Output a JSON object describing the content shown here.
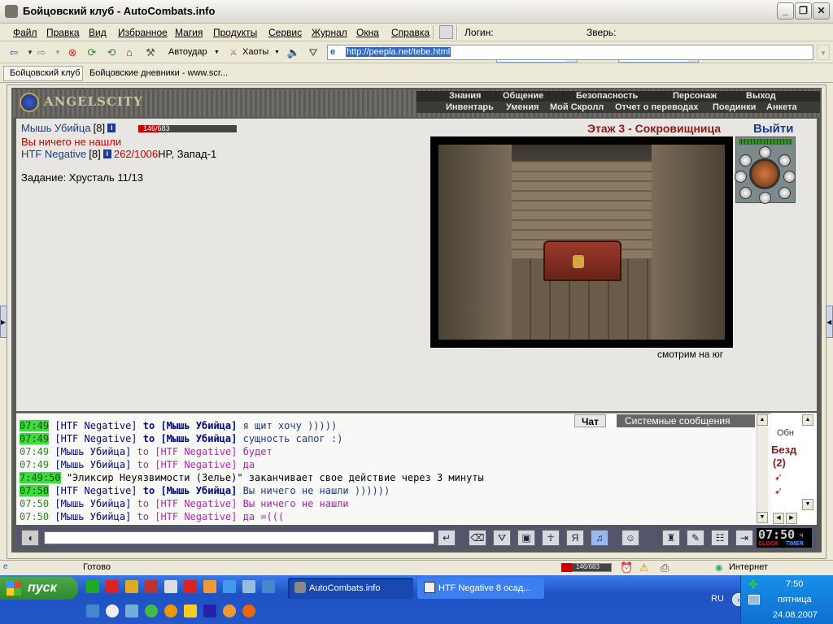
{
  "window": {
    "title": "Бойцовский клуб - AutoCombats.info"
  },
  "menubar": {
    "items": [
      "Файл",
      "Правка",
      "Вид",
      "Избранное",
      "Магия",
      "Продукты",
      "Сервис",
      "Журнал",
      "Окна",
      "Справка"
    ],
    "login_label": "Логин:",
    "pet_label": "Зверь:"
  },
  "toolbar": {
    "autoudar": "Автоудар",
    "haoty": "Хаоты",
    "address": "http://peepla.net/tebe.html"
  },
  "links": {
    "items": [
      "Бойцовский клуб",
      "Бойцовские дневники - www.scr..."
    ]
  },
  "site": {
    "logo": "ANGELSCITY",
    "nav_top": [
      "Знания",
      "Общение",
      "Безопасность",
      "Персонаж",
      "Выход"
    ],
    "nav_bottom": [
      "Инвентарь",
      "Умения",
      "Мой Скролл",
      "Отчет о переводах",
      "Поединки",
      "Анкета"
    ]
  },
  "game": {
    "player_name": "Мышь Убийца",
    "player_level": "[8]",
    "player_hp_text": "146/683",
    "player_hp_fraction": 0.21,
    "nothing_found": "Вы ничего не нашли",
    "partner_name": "HTF Negative",
    "partner_level": "[8]",
    "partner_hp": "262/1006",
    "partner_hp_suffix": "HP, Запад-1",
    "quest": "Задание: Хрусталь 11/13",
    "floor": "Этаж 3 - Сокровищница",
    "exit": "Выйти",
    "looking": "смотрим на юг",
    "colors": {
      "floor": "#8b1a1a",
      "player": "#1c3a8c",
      "hp": "#cc0000"
    }
  },
  "chat": {
    "tabs": [
      "Чат",
      "Системные сообщения"
    ],
    "lines": [
      {
        "time": "07:49",
        "hl": true,
        "from": "HTF Negative",
        "to": "Мышь Убийца",
        "text": "я щит хочу )))))",
        "own": false
      },
      {
        "time": "07:49",
        "hl": true,
        "from": "HTF Negative",
        "to": "Мышь Убийца",
        "text": "сущность сапог :)",
        "own": false
      },
      {
        "time": "07:49",
        "hl": false,
        "from": "Мышь Убийца",
        "to": "HTF Negative",
        "text": "будет",
        "own": true
      },
      {
        "time": "07:49",
        "hl": false,
        "from": "Мышь Убийца",
        "to": "HTF Negative",
        "text": "да",
        "own": true
      },
      {
        "time": "7:49:50",
        "hl": true,
        "system": true,
        "text": "\"Эликсир Неуязвимости (Зелье)\" заканчивает свое действие через 3 минуты"
      },
      {
        "time": "07:50",
        "hl": true,
        "from": "HTF Negative",
        "to": "Мышь Убийца",
        "text": "Вы ничего не нашли ))))))",
        "own": false
      },
      {
        "time": "07:50",
        "hl": false,
        "from": "Мышь Убийца",
        "to": "HTF Negative",
        "text": "Вы ничего не нашли",
        "own": true
      },
      {
        "time": "07:50",
        "hl": false,
        "from": "Мышь Убийца",
        "to": "HTF Negative",
        "text": "да =(((",
        "own": true
      }
    ],
    "side_refresh": "Обн",
    "side_label": "Безд",
    "side_count": "(2)"
  },
  "bottombar": {
    "clock": "07:50",
    "clock_suffix": "ч",
    "clock_label": "CLOCK",
    "timer_label": "TIMER"
  },
  "status": {
    "ready": "Готово",
    "hp_mini": "146/683",
    "zone": "Интернет"
  },
  "taskbar": {
    "start": "пуск",
    "tasks": [
      "AutoCombats.info",
      "HTF Negative 8 осад..."
    ],
    "lang": "RU",
    "time": "7:50",
    "day": "пятница",
    "date": "24.08.2007"
  }
}
